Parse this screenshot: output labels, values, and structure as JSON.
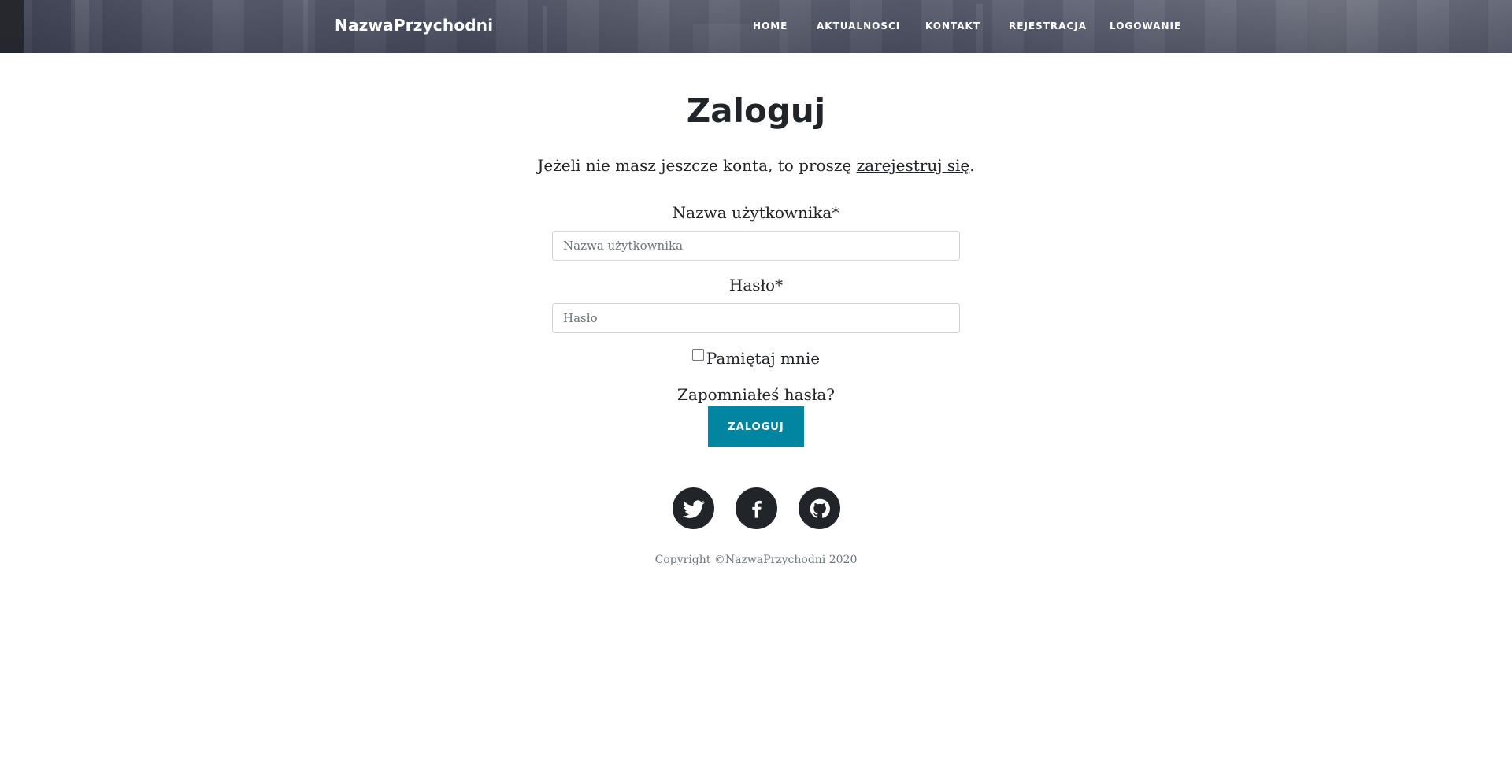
{
  "navbar": {
    "brand": "NazwaPrzychodni",
    "links": [
      "HOME",
      "AKTUALNOSCI",
      "KONTAKT",
      "REJESTRACJA",
      "LOGOWANIE"
    ]
  },
  "main": {
    "title": "Zaloguj",
    "subtitle_text": "Jeżeli nie masz jeszcze konta, to proszę ",
    "subtitle_link": "zarejestruj się",
    "subtitle_end": ".",
    "username_label": "Nazwa użytkownika*",
    "username_placeholder": "Nazwa użytkownika",
    "password_label": "Hasło*",
    "password_placeholder": "Hasło",
    "remember_label": "Pamiętaj mnie",
    "remember_checked": false,
    "forgot_label": "Zapomniałeś hasła?",
    "login_button": "ZALOGUJ"
  },
  "footer": {
    "social": [
      {
        "icon": "twitter-icon"
      },
      {
        "icon": "facebook-icon"
      },
      {
        "icon": "github-icon"
      }
    ],
    "copyright": "Copyright ©NazwaPrzychodni 2020"
  },
  "colors": {
    "accent": "#0085a1",
    "dark": "#212529",
    "muted": "#6c757d"
  }
}
